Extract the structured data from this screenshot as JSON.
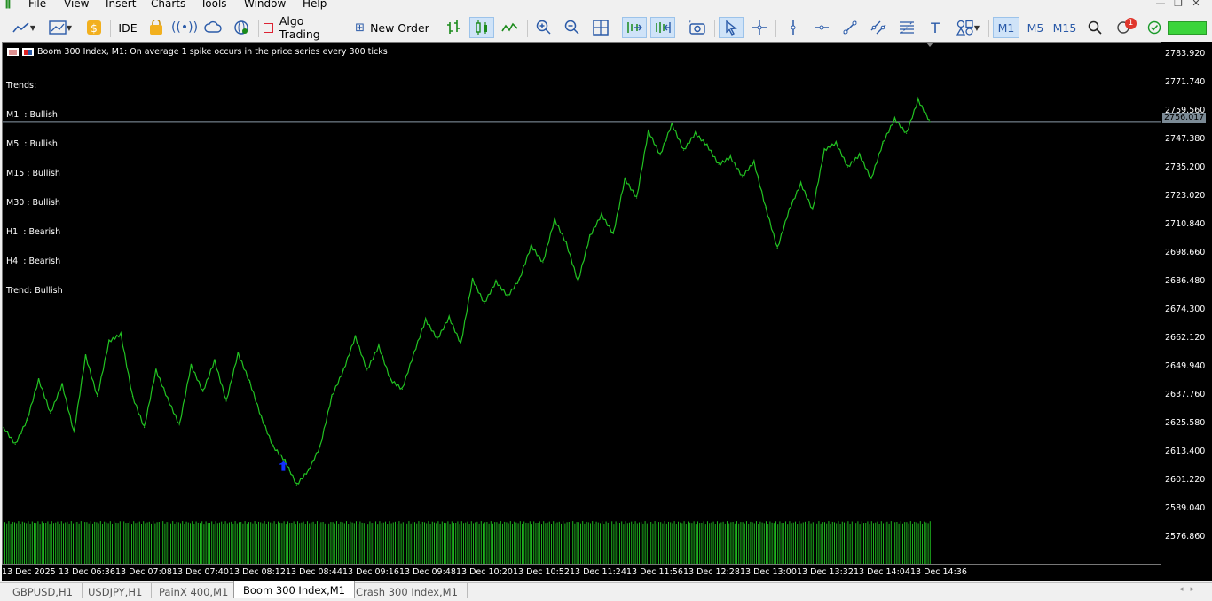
{
  "menu": [
    "File",
    "View",
    "Insert",
    "Charts",
    "Tools",
    "Window",
    "Help"
  ],
  "toolbar": {
    "ide_label": "IDE",
    "algo_trading_label": "Algo Trading",
    "new_order_label": "New Order",
    "timeframes": [
      "M1",
      "M5",
      "M15"
    ],
    "active_timeframe": "M1",
    "notification_count": "1"
  },
  "chart": {
    "header": "Boom 300 Index, M1:  On average 1 spike occurs in the price series every 300 ticks",
    "trends": [
      "Trends:",
      "M1  : Bullish",
      "M5  : Bullish",
      "M15 : Bullish",
      "M30 : Bullish",
      "H1  : Bearish",
      "H4  : Bearish",
      "Trend: Bullish"
    ],
    "current_price": "2756.017",
    "price_ticks": [
      "2783.920",
      "2771.740",
      "2759.560",
      "2747.380",
      "2735.200",
      "2723.020",
      "2710.840",
      "2698.660",
      "2686.480",
      "2674.300",
      "2662.120",
      "2649.940",
      "2637.760",
      "2625.580",
      "2613.400",
      "2601.220",
      "2589.040",
      "2576.860"
    ],
    "time_ticks": [
      "13 Dec 2025",
      "13 Dec 06:36",
      "13 Dec 07:08",
      "13 Dec 07:40",
      "13 Dec 08:12",
      "13 Dec 08:44",
      "13 Dec 09:16",
      "13 Dec 09:48",
      "13 Dec 10:20",
      "13 Dec 10:52",
      "13 Dec 11:24",
      "13 Dec 11:56",
      "13 Dec 12:28",
      "13 Dec 13:00",
      "13 Dec 13:32",
      "13 Dec 14:04",
      "13 Dec 14:36"
    ],
    "colors": {
      "line": "#22c322",
      "volume": "#1fb21f",
      "bg": "#000000",
      "buy_arrow": "#1030ff"
    }
  },
  "chart_data": {
    "type": "line",
    "x": [
      "13 Dec 2025",
      "13 Dec 06:36",
      "13 Dec 07:08",
      "13 Dec 07:40",
      "13 Dec 08:12",
      "13 Dec 08:44",
      "13 Dec 09:16",
      "13 Dec 09:48",
      "13 Dec 10:20",
      "13 Dec 10:52",
      "13 Dec 11:24",
      "13 Dec 11:56",
      "13 Dec 12:28",
      "13 Dec 13:00",
      "13 Dec 13:32",
      "13 Dec 14:04",
      "13 Dec 14:36"
    ],
    "points": [
      [
        "13 Dec 2025",
        2628
      ],
      [
        "13 Dec 2025",
        2621
      ],
      [
        "13 Dec 2025",
        2631
      ],
      [
        "13 Dec 2025",
        2648
      ],
      [
        "13 Dec 2025",
        2634
      ],
      [
        "13 Dec 06:36",
        2646
      ],
      [
        "13 Dec 06:36",
        2626
      ],
      [
        "13 Dec 06:36",
        2658
      ],
      [
        "13 Dec 06:36",
        2641
      ],
      [
        "13 Dec 06:36",
        2664
      ],
      [
        "13 Dec 07:08",
        2667
      ],
      [
        "13 Dec 07:08",
        2641
      ],
      [
        "13 Dec 07:08",
        2628
      ],
      [
        "13 Dec 07:08",
        2652
      ],
      [
        "13 Dec 07:08",
        2640
      ],
      [
        "13 Dec 07:40",
        2629
      ],
      [
        "13 Dec 07:40",
        2654
      ],
      [
        "13 Dec 07:40",
        2643
      ],
      [
        "13 Dec 07:40",
        2656
      ],
      [
        "13 Dec 07:40",
        2639
      ],
      [
        "13 Dec 08:12",
        2659
      ],
      [
        "13 Dec 08:12",
        2647
      ],
      [
        "13 Dec 08:12",
        2632
      ],
      [
        "13 Dec 08:12",
        2620
      ],
      [
        "13 Dec 08:12",
        2614
      ],
      [
        "13 Dec 08:44",
        2604
      ],
      [
        "13 Dec 08:44",
        2610
      ],
      [
        "13 Dec 08:44",
        2620
      ],
      [
        "13 Dec 08:44",
        2641
      ],
      [
        "13 Dec 08:44",
        2652
      ],
      [
        "13 Dec 09:16",
        2666
      ],
      [
        "13 Dec 09:16",
        2652
      ],
      [
        "13 Dec 09:16",
        2662
      ],
      [
        "13 Dec 09:16",
        2648
      ],
      [
        "13 Dec 09:16",
        2644
      ],
      [
        "13 Dec 09:48",
        2659
      ],
      [
        "13 Dec 09:48",
        2673
      ],
      [
        "13 Dec 09:48",
        2665
      ],
      [
        "13 Dec 09:48",
        2674
      ],
      [
        "13 Dec 09:48",
        2663
      ],
      [
        "13 Dec 10:20",
        2690
      ],
      [
        "13 Dec 10:20",
        2680
      ],
      [
        "13 Dec 10:20",
        2689
      ],
      [
        "13 Dec 10:20",
        2683
      ],
      [
        "13 Dec 10:20",
        2690
      ],
      [
        "13 Dec 10:52",
        2704
      ],
      [
        "13 Dec 10:52",
        2697
      ],
      [
        "13 Dec 10:52",
        2715
      ],
      [
        "13 Dec 10:52",
        2705
      ],
      [
        "13 Dec 10:52",
        2689
      ],
      [
        "13 Dec 11:24",
        2708
      ],
      [
        "13 Dec 11:24",
        2717
      ],
      [
        "13 Dec 11:24",
        2709
      ],
      [
        "13 Dec 11:24",
        2732
      ],
      [
        "13 Dec 11:24",
        2724
      ],
      [
        "13 Dec 11:56",
        2752
      ],
      [
        "13 Dec 11:56",
        2742
      ],
      [
        "13 Dec 11:56",
        2755
      ],
      [
        "13 Dec 11:56",
        2744
      ],
      [
        "13 Dec 11:56",
        2751
      ],
      [
        "13 Dec 12:28",
        2746
      ],
      [
        "13 Dec 12:28",
        2738
      ],
      [
        "13 Dec 12:28",
        2741
      ],
      [
        "13 Dec 12:28",
        2733
      ],
      [
        "13 Dec 12:28",
        2739
      ],
      [
        "13 Dec 13:00",
        2720
      ],
      [
        "13 Dec 13:00",
        2703
      ],
      [
        "13 Dec 13:00",
        2719
      ],
      [
        "13 Dec 13:00",
        2730
      ],
      [
        "13 Dec 13:00",
        2719
      ],
      [
        "13 Dec 13:32",
        2744
      ],
      [
        "13 Dec 13:32",
        2747
      ],
      [
        "13 Dec 13:32",
        2737
      ],
      [
        "13 Dec 13:32",
        2742
      ],
      [
        "13 Dec 13:32",
        2732
      ],
      [
        "13 Dec 14:04",
        2747
      ],
      [
        "13 Dec 14:04",
        2757
      ],
      [
        "13 Dec 14:04",
        2751
      ],
      [
        "13 Dec 14:04",
        2765
      ],
      [
        "13 Dec 14:04",
        2756
      ]
    ],
    "volume_level": 2588.8,
    "buy_signal": [
      "13 Dec 08:44",
      2612
    ],
    "ylim": [
      2571,
      2789
    ],
    "grid": false,
    "title": "",
    "xlabel": "",
    "ylabel": ""
  },
  "tabs": [
    "GBPUSD,H1",
    "USDJPY,H1",
    "PainX 400,M1",
    "Boom 300 Index,M1",
    "Crash 300 Index,M1"
  ],
  "active_tab": "Boom 300 Index,M1"
}
